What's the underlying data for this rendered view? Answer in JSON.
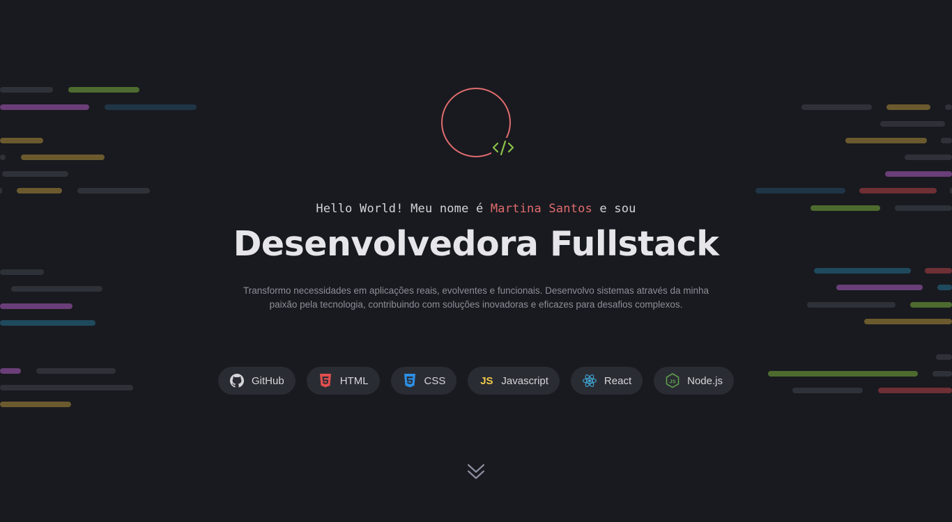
{
  "hero": {
    "intro_prefix": "Hello World! Meu nome é ",
    "name": "Martina Santos",
    "intro_suffix": " e sou",
    "title": "Desenvolvedora Fullstack",
    "description": "Transformo necessidades em aplicações reais, evolventes e funcionais. Desenvolvo sistemas através da minha paixão pela tecnologia, contribuindo com soluções inovadoras e eficazes para desafios complexos."
  },
  "logo": {
    "icon": "code-icon",
    "ring_color": "#e06c6e",
    "icon_color": "#8bc34a"
  },
  "techs": [
    {
      "label": "GitHub",
      "icon": "github-icon",
      "color": "#d6d6da"
    },
    {
      "label": "HTML",
      "icon": "html5-icon",
      "color": "#e34f4f"
    },
    {
      "label": "CSS",
      "icon": "css3-icon",
      "color": "#2d8fe3"
    },
    {
      "label": "Javascript",
      "icon": "js-icon",
      "color": "#f0c94c",
      "badge": "JS"
    },
    {
      "label": "React",
      "icon": "react-icon",
      "color": "#3fa9d8"
    },
    {
      "label": "Node.js",
      "icon": "nodejs-icon",
      "color": "#5fa04e"
    }
  ],
  "scroll": {
    "icon": "chevron-double-down-icon"
  },
  "colors": {
    "background": "#191a1f",
    "accent": "#e06c6e",
    "chip_bg": "#2a2c33",
    "text": "#e6e6ea",
    "muted": "#8c8f99"
  }
}
